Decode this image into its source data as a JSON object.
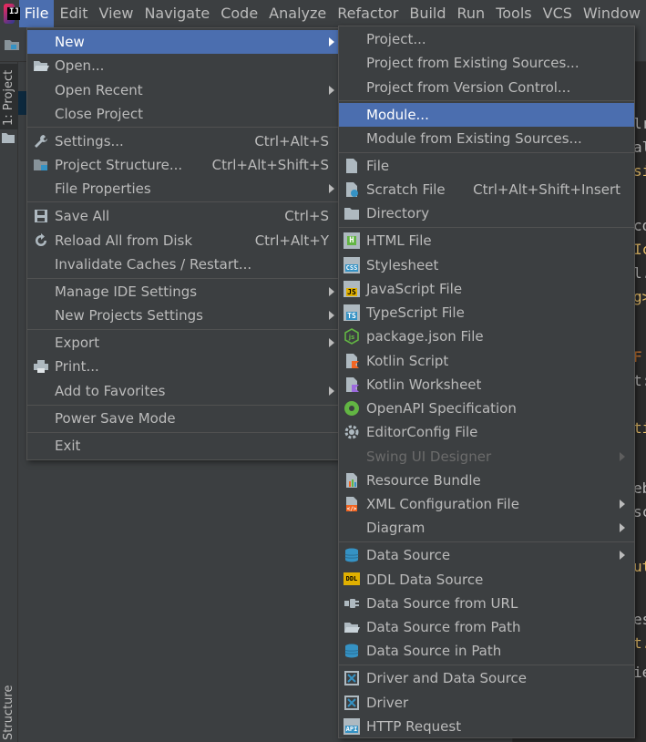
{
  "menubar": {
    "items": [
      {
        "label": "File",
        "active": true
      },
      {
        "label": "Edit"
      },
      {
        "label": "View"
      },
      {
        "label": "Navigate"
      },
      {
        "label": "Code"
      },
      {
        "label": "Analyze"
      },
      {
        "label": "Refactor"
      },
      {
        "label": "Build"
      },
      {
        "label": "Run"
      },
      {
        "label": "Tools"
      },
      {
        "label": "VCS"
      },
      {
        "label": "Window"
      }
    ]
  },
  "side": {
    "project": "1: Project",
    "structure": "Structure"
  },
  "editor_fragments": [
    "lr",
    "al",
    "si",
    "co",
    "Ic",
    "l.",
    "g>",
    "F",
    "t:/",
    "ti",
    "eb",
    "sc",
    "ut",
    "es",
    "t.",
    "ie"
  ],
  "file_menu": {
    "items": [
      {
        "label": "New"
      },
      {
        "label": "Open..."
      },
      {
        "label": "Open Recent"
      },
      {
        "label": "Close Project"
      },
      {
        "label": "Settings...",
        "shortcut": "Ctrl+Alt+S"
      },
      {
        "label": "Project Structure...",
        "shortcut": "Ctrl+Alt+Shift+S"
      },
      {
        "label": "File Properties"
      },
      {
        "label": "Save All",
        "shortcut": "Ctrl+S"
      },
      {
        "label": "Reload All from Disk",
        "shortcut": "Ctrl+Alt+Y"
      },
      {
        "label": "Invalidate Caches / Restart..."
      },
      {
        "label": "Manage IDE Settings"
      },
      {
        "label": "New Projects Settings"
      },
      {
        "label": "Export"
      },
      {
        "label": "Print..."
      },
      {
        "label": "Add to Favorites"
      },
      {
        "label": "Power Save Mode"
      },
      {
        "label": "Exit"
      }
    ]
  },
  "new_menu": {
    "items": [
      {
        "label": "Project..."
      },
      {
        "label": "Project from Existing Sources..."
      },
      {
        "label": "Project from Version Control..."
      },
      {
        "label": "Module..."
      },
      {
        "label": "Module from Existing Sources..."
      },
      {
        "label": "File"
      },
      {
        "label": "Scratch File",
        "shortcut": "Ctrl+Alt+Shift+Insert"
      },
      {
        "label": "Directory"
      },
      {
        "label": "HTML File"
      },
      {
        "label": "Stylesheet"
      },
      {
        "label": "JavaScript File"
      },
      {
        "label": "TypeScript File"
      },
      {
        "label": "package.json File"
      },
      {
        "label": "Kotlin Script"
      },
      {
        "label": "Kotlin Worksheet"
      },
      {
        "label": "OpenAPI Specification"
      },
      {
        "label": "EditorConfig File"
      },
      {
        "label": "Swing UI Designer"
      },
      {
        "label": "Resource Bundle"
      },
      {
        "label": "XML Configuration File"
      },
      {
        "label": "Diagram"
      },
      {
        "label": "Data Source"
      },
      {
        "label": "DDL Data Source"
      },
      {
        "label": "Data Source from URL"
      },
      {
        "label": "Data Source from Path"
      },
      {
        "label": "Data Source in Path"
      },
      {
        "label": "Driver and Data Source"
      },
      {
        "label": "Driver"
      },
      {
        "label": "HTTP Request"
      }
    ]
  },
  "icon_labels": {
    "html": "H",
    "css": "CSS",
    "js": "JS",
    "ts": "TS",
    "ddl": "DDL",
    "api": "API"
  },
  "colors": {
    "selection": "#4b6eaf",
    "menu_bg": "#3c3f41",
    "text": "#bbbbbb",
    "disabled": "#6b6b6b"
  }
}
